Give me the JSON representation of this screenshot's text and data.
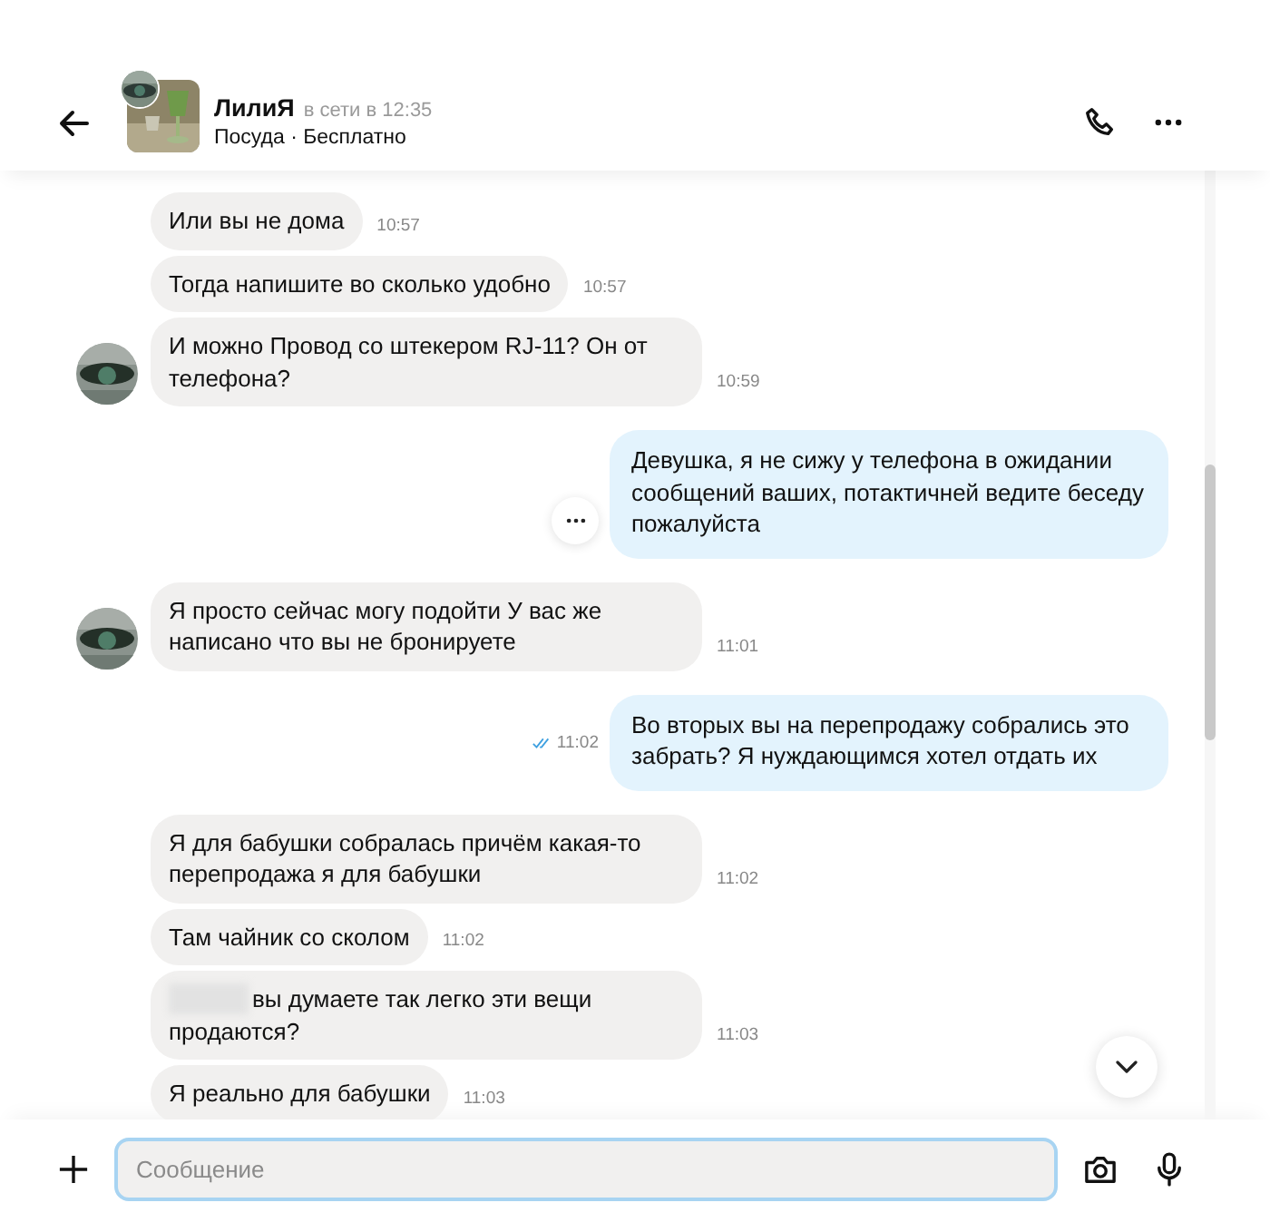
{
  "header": {
    "name": "ЛилиЯ",
    "status": "в сети в 12:35",
    "subtitle": "Посуда · Бесплатно"
  },
  "messages": [
    {
      "kind": "in",
      "text": "Или вы не дома",
      "time": "10:57",
      "avatar": false
    },
    {
      "kind": "in",
      "text": "Тогда напишите во сколько удобно",
      "time": "10:57",
      "avatar": false
    },
    {
      "kind": "in",
      "text": "И можно Провод со штекером RJ-11? Он от телефона?",
      "time": "10:59",
      "avatar": true
    },
    {
      "kind": "out",
      "text": "Девушка, я не сижу у телефона в ожидании сообщений ваших, потактичней ведите беседу пожалуйста",
      "menu": true
    },
    {
      "kind": "in",
      "text": "Я просто сейчас могу подойти У вас же написано что вы не бронируете",
      "time": "11:01",
      "avatar": true
    },
    {
      "kind": "out",
      "text": "Во вторых вы на перепродажу собрались это забрать? Я нуждающимся хотел отдать их",
      "time": "11:02",
      "read": true
    },
    {
      "kind": "in",
      "text": "Я для бабушки собралась причём какая-то перепродажа я для бабушки",
      "time": "11:02",
      "avatar": false
    },
    {
      "kind": "in",
      "text": "Там чайник со сколом",
      "time": "11:02",
      "avatar": false
    },
    {
      "kind": "in",
      "text": "вы думаете так легко эти вещи продаются?",
      "time": "11:03",
      "avatar": false,
      "redacted": true
    },
    {
      "kind": "in",
      "text": "Я реально для бабушки",
      "time": "11:03",
      "avatar": false
    }
  ],
  "composer": {
    "placeholder": "Сообщение"
  }
}
